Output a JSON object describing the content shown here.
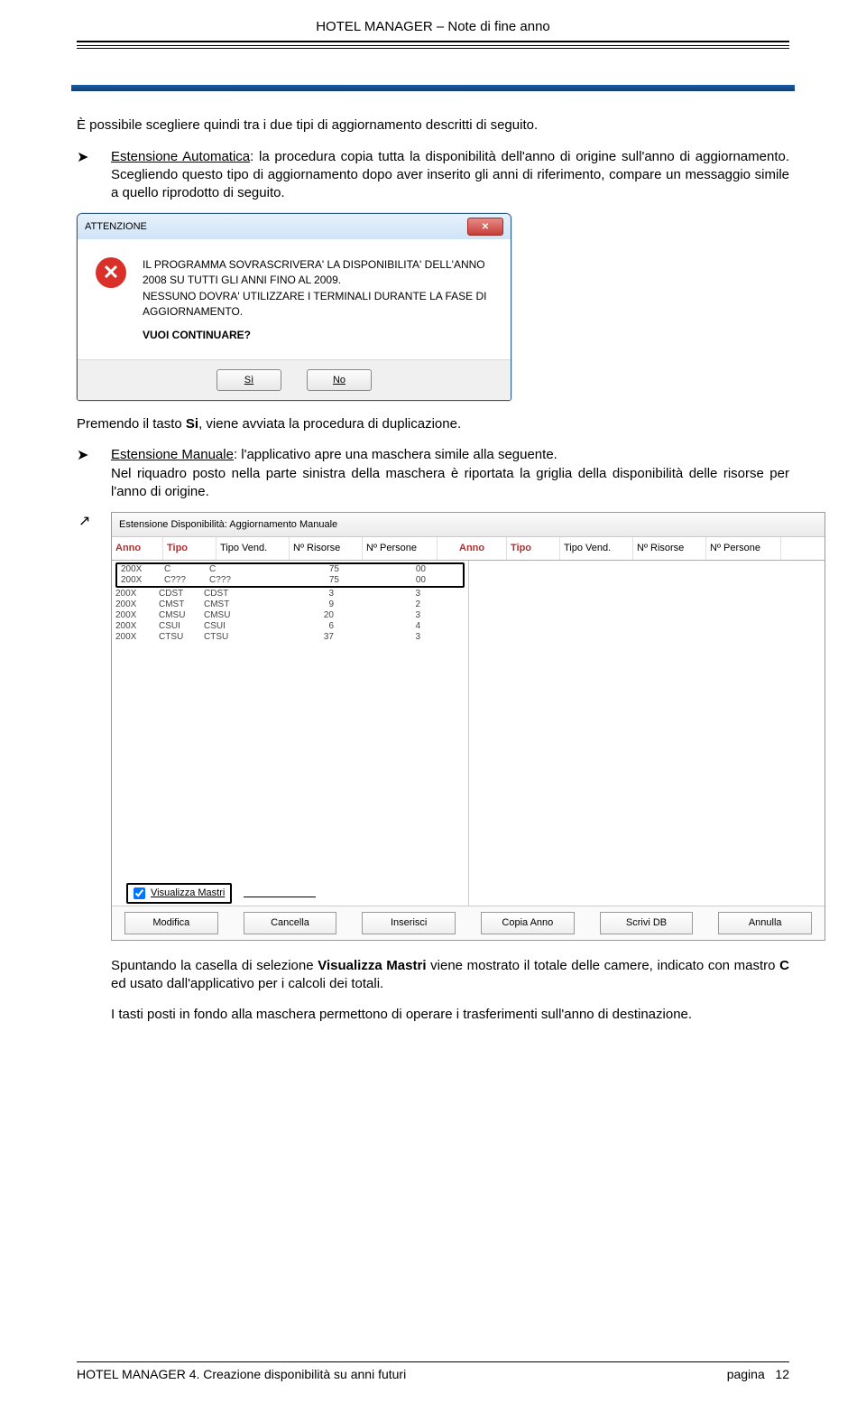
{
  "header": {
    "title": "HOTEL MANAGER – Note di fine anno"
  },
  "intro": "È possibile scegliere quindi tra i due tipi di aggiornamento descritti di seguito.",
  "ext_auto": {
    "label": "Estensione Automatica",
    "text": ": la procedura copia tutta la disponibilità dell'anno di origine sull'anno di aggiornamento. Scegliendo questo tipo di aggiornamento dopo aver inserito gli anni di riferimento, compare un messaggio simile a quello riprodotto di seguito."
  },
  "dialog": {
    "title": "ATTENZIONE",
    "line1": "IL PROGRAMMA SOVRASCRIVERA' LA DISPONIBILITA' DELL'ANNO",
    "line2": "2008 SU TUTTI GLI ANNI FINO AL 2009.",
    "line3": "NESSUNO DOVRA' UTILIZZARE I TERMINALI DURANTE LA FASE DI",
    "line4": "AGGIORNAMENTO.",
    "question": "VUOI CONTINUARE?",
    "btn_yes": "Sì",
    "btn_no": "No"
  },
  "after_dlg": {
    "t1": "Premendo il tasto ",
    "si": "Si",
    "t2": ", viene avviata la procedura di duplicazione."
  },
  "ext_man": {
    "label": "Estensione Manuale",
    "text": ": l'applicativo apre una maschera simile alla seguente.",
    "text2": "Nel riquadro posto nella parte sinistra della maschera è riportata la griglia della disponibilità delle risorse per l'anno di origine."
  },
  "grid": {
    "title": "Estensione Disponibilità: Aggiornamento Manuale",
    "headersL": [
      "Anno",
      "Tipo",
      "Tipo Vend.",
      "Nº Risorse",
      "Nº Persone"
    ],
    "headersR": [
      "Anno",
      "Tipo",
      "Tipo Vend.",
      "Nº Risorse",
      "Nº Persone"
    ],
    "rows": [
      [
        "200X",
        "C",
        "C",
        "75",
        "00"
      ],
      [
        "200X",
        "C???",
        "C???",
        "75",
        "00"
      ],
      [
        "200X",
        "CDST",
        "CDST",
        "3",
        "3"
      ],
      [
        "200X",
        "CMST",
        "CMST",
        "9",
        "2"
      ],
      [
        "200X",
        "CMSU",
        "CMSU",
        "20",
        "3"
      ],
      [
        "200X",
        "CSUI",
        "CSUI",
        "6",
        "4"
      ],
      [
        "200X",
        "CTSU",
        "CTSU",
        "37",
        "3"
      ]
    ],
    "checkbox": "Visualizza Mastri",
    "buttons": [
      "Modifica",
      "Cancella",
      "Inserisci",
      "Copia Anno",
      "Scrivi DB",
      "Annulla"
    ]
  },
  "post": {
    "p1a": "Spuntando la casella di selezione ",
    "p1b": "Visualizza Mastri",
    "p1c": " viene mostrato il totale delle camere, indicato con mastro ",
    "p1d": "C",
    "p1e": " ed usato dall'applicativo per i calcoli dei totali.",
    "p2": "I tasti posti in fondo alla maschera permettono di operare i trasferimenti sull'anno di destinazione."
  },
  "footer": {
    "left": "HOTEL MANAGER 4. Creazione disponibilità su anni futuri",
    "right_label": "pagina",
    "right_num": "12"
  },
  "bullet": "➤"
}
